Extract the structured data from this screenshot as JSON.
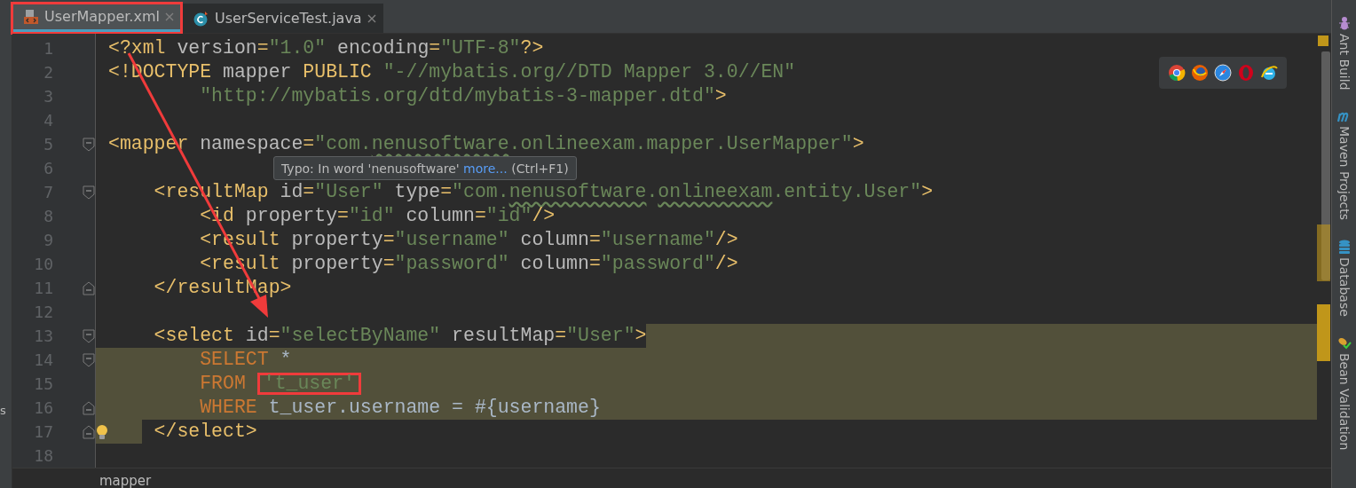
{
  "tabs": [
    {
      "label": "UserMapper.xml",
      "kind": "xml",
      "selected": true,
      "annotated": true
    },
    {
      "label": "UserServiceTest.java",
      "kind": "java",
      "selected": false,
      "annotated": false
    }
  ],
  "left_panel_fragment": "s",
  "lines": [
    {
      "number": "1",
      "kind": "plain",
      "tokens": [
        {
          "kind": "tag",
          "text": "<?xml "
        },
        {
          "kind": "attr",
          "text": "version"
        },
        {
          "kind": "tag",
          "text": "="
        },
        {
          "kind": "str",
          "text": "\"1.0\""
        },
        {
          "kind": "attr",
          "text": " encoding"
        },
        {
          "kind": "tag",
          "text": "="
        },
        {
          "kind": "str",
          "text": "\"UTF-8\""
        },
        {
          "kind": "tag",
          "text": "?>"
        }
      ]
    },
    {
      "number": "2",
      "kind": "plain",
      "tokens": [
        {
          "kind": "tag",
          "text": "<!DOCTYPE "
        },
        {
          "kind": "attr",
          "text": "mapper "
        },
        {
          "kind": "tag",
          "text": "PUBLIC "
        },
        {
          "kind": "str",
          "text": "\"-//mybatis.org//DTD Mapper 3.0//EN\""
        }
      ]
    },
    {
      "number": "3",
      "kind": "plain",
      "tokens": [
        {
          "kind": "str",
          "text": "        \"http://mybatis.org/dtd/mybatis-3-mapper.dtd\""
        },
        {
          "kind": "tag",
          "text": ">"
        }
      ]
    },
    {
      "number": "4",
      "kind": "plain"
    },
    {
      "number": "5",
      "kind": "plain",
      "fold_start": true,
      "tokens": [
        {
          "kind": "tag",
          "text": "<mapper "
        },
        {
          "kind": "attr",
          "text": "namespace"
        },
        {
          "kind": "tag",
          "text": "="
        },
        {
          "kind": "str",
          "text": "\"com."
        },
        {
          "kind": "typo",
          "text": "nenusoftware"
        },
        {
          "kind": "str",
          "text": ".onlineexam.mapper.UserMapper\""
        },
        {
          "kind": "tag",
          "text": ">"
        }
      ]
    },
    {
      "number": "6",
      "kind": "plain",
      "tooltip": {
        "text": "Typo: In word 'nenusoftware' ",
        "link": "more...",
        "shortcut": " (Ctrl+F1)"
      }
    },
    {
      "number": "7",
      "kind": "plain",
      "fold_start": true,
      "tokens": [
        {
          "kind": "tag",
          "text": "    <resultMap "
        },
        {
          "kind": "attr",
          "text": "id"
        },
        {
          "kind": "tag",
          "text": "="
        },
        {
          "kind": "str",
          "text": "\"User\" "
        },
        {
          "kind": "attr",
          "text": "type"
        },
        {
          "kind": "tag",
          "text": "="
        },
        {
          "kind": "str",
          "text": "\"com."
        },
        {
          "kind": "typo",
          "text": "nenusoftware"
        },
        {
          "kind": "str",
          "text": "."
        },
        {
          "kind": "typo",
          "text": "onlineexam"
        },
        {
          "kind": "str",
          "text": ".entity.User\""
        },
        {
          "kind": "tag",
          "text": ">"
        }
      ]
    },
    {
      "number": "8",
      "kind": "plain",
      "tokens": [
        {
          "kind": "tag",
          "text": "        <id "
        },
        {
          "kind": "attr",
          "text": "property"
        },
        {
          "kind": "tag",
          "text": "="
        },
        {
          "kind": "str",
          "text": "\"id\" "
        },
        {
          "kind": "attr",
          "text": "column"
        },
        {
          "kind": "tag",
          "text": "="
        },
        {
          "kind": "str",
          "text": "\"id\""
        },
        {
          "kind": "tag",
          "text": "/>"
        }
      ]
    },
    {
      "number": "9",
      "kind": "plain",
      "tokens": [
        {
          "kind": "tag",
          "text": "        <result "
        },
        {
          "kind": "attr",
          "text": "property"
        },
        {
          "kind": "tag",
          "text": "="
        },
        {
          "kind": "str",
          "text": "\"username\" "
        },
        {
          "kind": "attr",
          "text": "column"
        },
        {
          "kind": "tag",
          "text": "="
        },
        {
          "kind": "str",
          "text": "\"username\""
        },
        {
          "kind": "tag",
          "text": "/>"
        }
      ]
    },
    {
      "number": "10",
      "kind": "plain",
      "tokens": [
        {
          "kind": "tag",
          "text": "        <result "
        },
        {
          "kind": "attr",
          "text": "property"
        },
        {
          "kind": "tag",
          "text": "="
        },
        {
          "kind": "str",
          "text": "\"password\" "
        },
        {
          "kind": "attr",
          "text": "column"
        },
        {
          "kind": "tag",
          "text": "="
        },
        {
          "kind": "str",
          "text": "\"password\""
        },
        {
          "kind": "tag",
          "text": "/>"
        }
      ]
    },
    {
      "number": "11",
      "kind": "plain",
      "fold_end": true,
      "tokens": [
        {
          "kind": "tag",
          "text": "    </resultMap>"
        }
      ]
    },
    {
      "number": "12",
      "kind": "plain"
    },
    {
      "number": "13",
      "kind": "trailing",
      "fold_start": true,
      "tokens": [
        {
          "kind": "tag",
          "text": "    <select "
        },
        {
          "kind": "attr",
          "text": "id"
        },
        {
          "kind": "tag",
          "text": "="
        },
        {
          "kind": "str",
          "text": "\"selectByName\" "
        },
        {
          "kind": "attr",
          "text": "resultMap"
        },
        {
          "kind": "tag",
          "text": "="
        },
        {
          "kind": "str",
          "text": "\"User\""
        },
        {
          "kind": "tag",
          "text": ">"
        }
      ]
    },
    {
      "number": "14",
      "kind": "full",
      "fold_start": true,
      "tokens": [
        {
          "kind": "kw",
          "text": "        SELECT "
        },
        {
          "kind": "plain",
          "text": "*"
        }
      ]
    },
    {
      "number": "15",
      "kind": "full",
      "tokens": [
        {
          "kind": "kw",
          "text": "        FROM "
        },
        {
          "kind": "boxedstr",
          "text": "'t_user'"
        }
      ]
    },
    {
      "number": "16",
      "kind": "full",
      "fold_end": true,
      "tokens": [
        {
          "kind": "kw",
          "text": "        WHERE "
        },
        {
          "kind": "plain",
          "text": "t_user.username = #{username}"
        }
      ]
    },
    {
      "number": "17",
      "kind": "indent",
      "fold_end": true,
      "bulb": true,
      "tokens": [
        {
          "kind": "tag",
          "text": "    </select>"
        }
      ]
    },
    {
      "number": "18",
      "kind": "plain"
    }
  ],
  "breadcrumb": "mapper",
  "tool_windows": [
    {
      "label": "Ant Build",
      "kind": "ant"
    },
    {
      "label": "Maven Projects",
      "kind": "maven"
    },
    {
      "label": "Database",
      "kind": "database"
    },
    {
      "label": "Bean Validation",
      "kind": "bean"
    }
  ]
}
